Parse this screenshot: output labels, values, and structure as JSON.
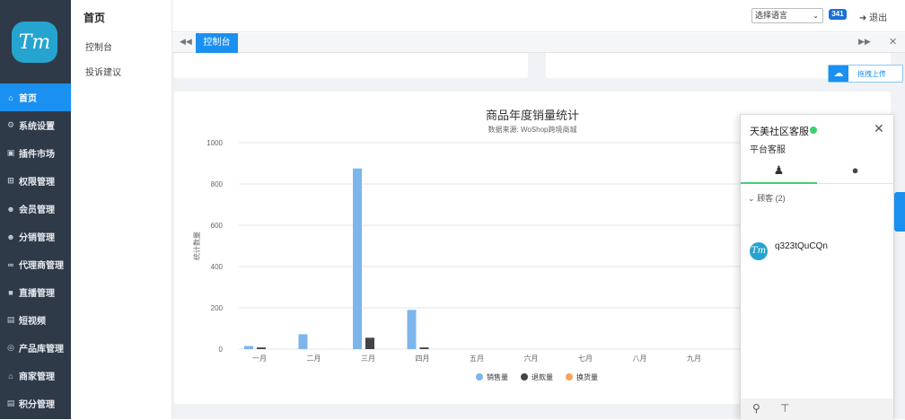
{
  "app": {
    "logo": "Tm"
  },
  "sidebar": {
    "items": [
      {
        "label": "首页",
        "icon": "home-icon",
        "glyph": "⌂",
        "active": true
      },
      {
        "label": "系统设置",
        "icon": "gear-icon",
        "glyph": "⚙"
      },
      {
        "label": "插件市场",
        "icon": "plugin-icon",
        "glyph": "▣"
      },
      {
        "label": "权限管理",
        "icon": "sitemap-icon",
        "glyph": "⊞"
      },
      {
        "label": "会员管理",
        "icon": "users-icon",
        "glyph": "☻"
      },
      {
        "label": "分销管理",
        "icon": "users-icon",
        "glyph": "☻"
      },
      {
        "label": "代理商管理",
        "icon": "share-icon",
        "glyph": "∞"
      },
      {
        "label": "直播管理",
        "icon": "video-icon",
        "glyph": "■"
      },
      {
        "label": "短视频",
        "icon": "file-icon",
        "glyph": "▤"
      },
      {
        "label": "产品库管理",
        "icon": "globe-icon",
        "glyph": "◎"
      },
      {
        "label": "商家管理",
        "icon": "bank-icon",
        "glyph": "⌂"
      },
      {
        "label": "积分管理",
        "icon": "file-icon",
        "glyph": "▤"
      }
    ]
  },
  "subnav": {
    "title": "首页",
    "items": [
      "控制台",
      "投诉建议"
    ]
  },
  "topbar": {
    "language": "选择语言",
    "badge": "341",
    "logout": "退出"
  },
  "tabs": {
    "active": "控制台"
  },
  "upload": {
    "label": "拖拽上传"
  },
  "chart_data": {
    "type": "bar",
    "title": "商品年度销量统计",
    "subtitle": "数据来源: WoShop跨境商城",
    "ylabel": "统计数量",
    "xlabel": "",
    "categories": [
      "一月",
      "二月",
      "三月",
      "四月",
      "五月",
      "六月",
      "七月",
      "八月",
      "九月"
    ],
    "series": [
      {
        "name": "销售量",
        "color": "#7cb5ec",
        "values": [
          15,
          72,
          875,
          190,
          0,
          0,
          0,
          0,
          0
        ]
      },
      {
        "name": "退款量",
        "color": "#434348",
        "values": [
          8,
          0,
          55,
          8,
          0,
          0,
          0,
          0,
          0
        ]
      },
      {
        "name": "换货量",
        "color": "#f7a35c",
        "values": [
          0,
          0,
          0,
          0,
          0,
          0,
          0,
          0,
          0
        ]
      }
    ],
    "ylim": [
      0,
      1000
    ],
    "yticks": [
      0,
      200,
      400,
      600,
      800,
      1000
    ],
    "grid": true,
    "legend": "bottom-center"
  },
  "chat": {
    "title": "天美社区客服",
    "subtitle": "平台客服",
    "group_label": "顾客",
    "group_count": "(2)",
    "visitor_name": "q323tQuCQn",
    "avatar_text": "Tm"
  }
}
